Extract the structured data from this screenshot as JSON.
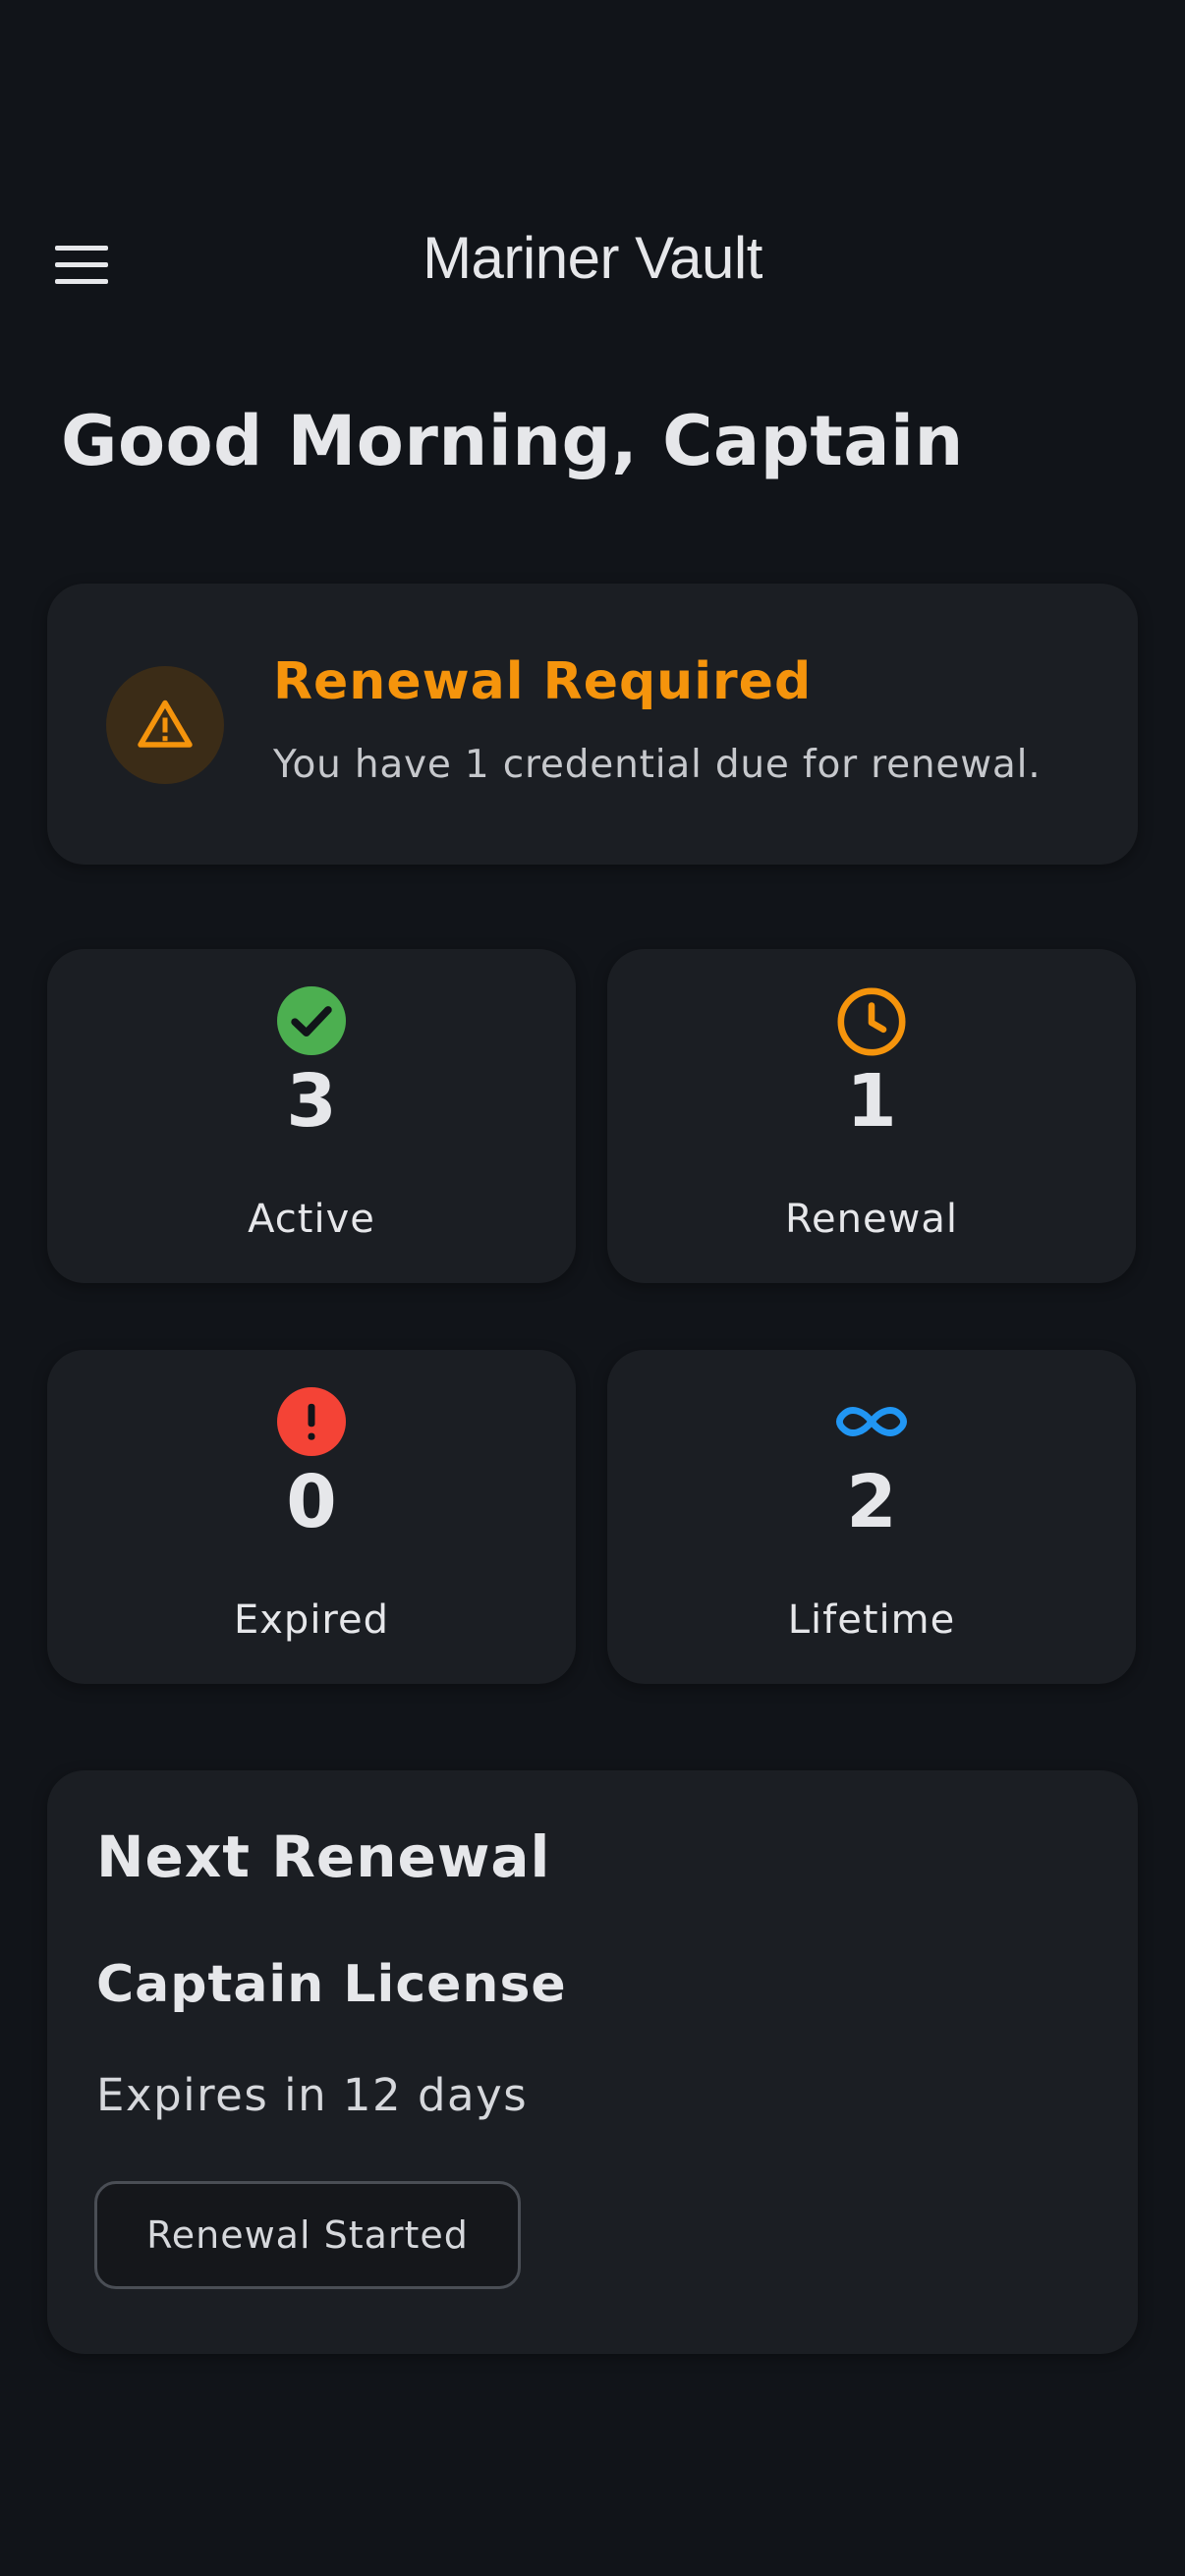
{
  "app": {
    "title": "Mariner Vault",
    "menu_icon": "hamburger-menu-icon"
  },
  "greeting": "Good Morning, Captain",
  "alert": {
    "icon": "warning-triangle-icon",
    "title": "Renewal Required",
    "message": "You have 1 credential due for renewal.",
    "color": "#f5940c"
  },
  "stats": [
    {
      "icon": "check-circle-icon",
      "value": "3",
      "label": "Active",
      "color": "#4caf50"
    },
    {
      "icon": "clock-icon",
      "value": "1",
      "label": "Renewal",
      "color": "#f5940c"
    },
    {
      "icon": "error-circle-icon",
      "value": "0",
      "label": "Expired",
      "color": "#f44336"
    },
    {
      "icon": "infinity-icon",
      "value": "2",
      "label": "Lifetime",
      "color": "#2196f3"
    }
  ],
  "next_renewal": {
    "heading": "Next Renewal",
    "credential": "Captain License",
    "expiry_text": "Expires in 12 days",
    "button_label": "Renewal Started"
  }
}
